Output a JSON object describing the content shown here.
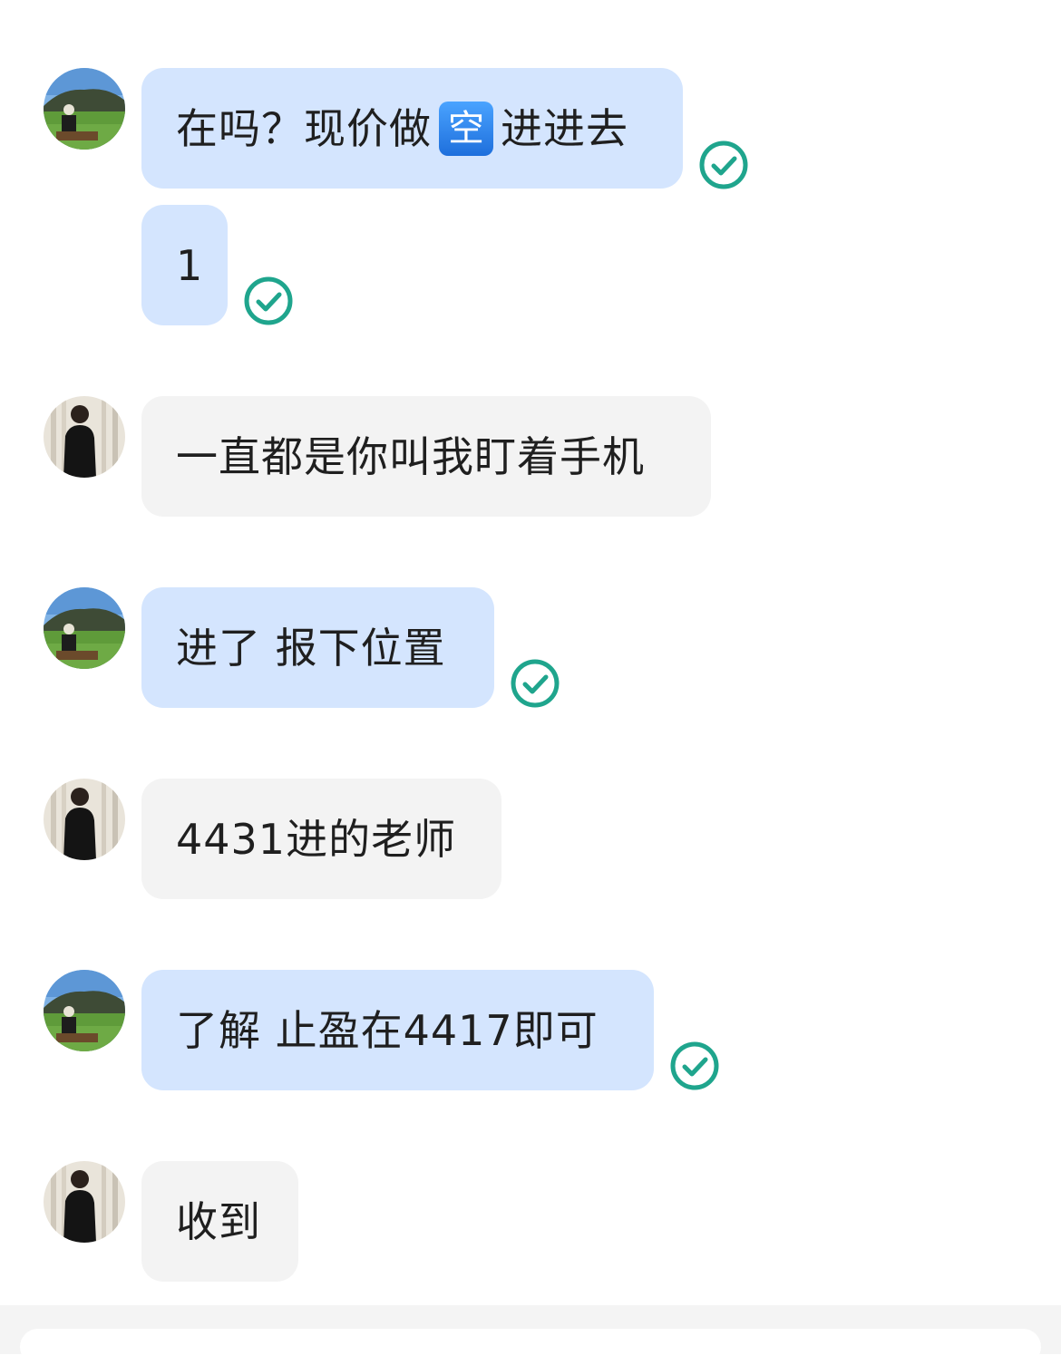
{
  "messages": [
    {
      "sender": "me",
      "text_before": "在吗？现价做",
      "emoji": "空",
      "text_after": "进进去",
      "status": "read-check-icon"
    },
    {
      "sender": "me",
      "text": "1",
      "status": "read-check-icon"
    },
    {
      "sender": "other",
      "text": "一直都是你叫我盯着手机"
    },
    {
      "sender": "me",
      "text": "进了 报下位置",
      "status": "read-check-icon"
    },
    {
      "sender": "other",
      "text": "4431进的老师"
    },
    {
      "sender": "me",
      "text": "了解 止盈在4417即可",
      "status": "read-check-icon"
    },
    {
      "sender": "other",
      "text": "收到"
    }
  ],
  "colors": {
    "my_bubble": "#d4e5fe",
    "their_bubble": "#f3f3f3",
    "check": "#1fa58d",
    "emoji_box": "#2a7fe8"
  }
}
